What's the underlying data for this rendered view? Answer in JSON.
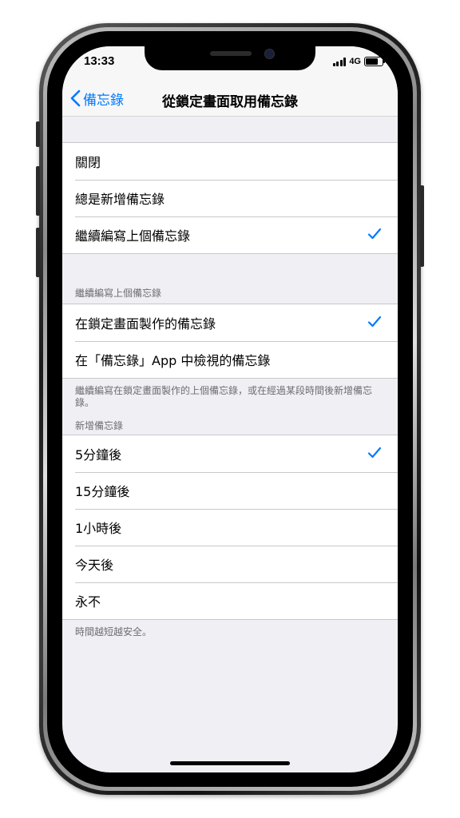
{
  "status_bar": {
    "time": "13:33",
    "network": "4G",
    "battery_level": 0.85
  },
  "nav": {
    "back_label": "備忘錄",
    "title": "從鎖定畫面取用備忘錄"
  },
  "access_group": {
    "items": [
      {
        "label": "關閉",
        "checked": false
      },
      {
        "label": "總是新增備忘錄",
        "checked": false
      },
      {
        "label": "繼續編寫上個備忘錄",
        "checked": true
      }
    ]
  },
  "resume_group": {
    "header": "繼續編寫上個備忘錄",
    "items": [
      {
        "label": "在鎖定畫面製作的備忘錄",
        "checked": true
      },
      {
        "label": "在「備忘錄」App 中檢視的備忘錄",
        "checked": false
      }
    ],
    "footer": "繼續編寫在鎖定畫面製作的上個備忘錄，或在經過某段時間後新增備忘錄。"
  },
  "new_note_group": {
    "header": "新增備忘錄",
    "items": [
      {
        "label": "5分鐘後",
        "checked": true
      },
      {
        "label": "15分鐘後",
        "checked": false
      },
      {
        "label": "1小時後",
        "checked": false
      },
      {
        "label": "今天後",
        "checked": false
      },
      {
        "label": "永不",
        "checked": false
      }
    ],
    "footer": "時間越短越安全。"
  },
  "colors": {
    "accent": "#007aff",
    "background": "#efeff4",
    "separator": "#c8c7cc"
  },
  "icons": {
    "back": "chevron-left-icon",
    "check": "checkmark-icon"
  }
}
